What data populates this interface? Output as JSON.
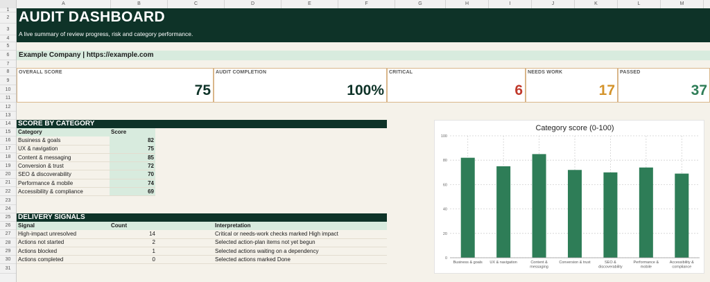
{
  "columns": [
    "A",
    "B",
    "C",
    "D",
    "E",
    "F",
    "G",
    "H",
    "I",
    "J",
    "K",
    "L",
    "M"
  ],
  "rows": [
    "1",
    "2",
    "3",
    "4",
    "5",
    "6",
    "7",
    "8",
    "9",
    "10",
    "11",
    "12",
    "13",
    "14",
    "15",
    "16",
    "17",
    "18",
    "19",
    "20",
    "21",
    "22",
    "23",
    "24",
    "25",
    "26",
    "27",
    "28",
    "29",
    "30",
    "31"
  ],
  "header": {
    "title": "AUDIT DASHBOARD",
    "subtitle": "A live summary of review progress, risk and category performance.",
    "company": "Example Company  |  https://example.com"
  },
  "cards": [
    {
      "label": "OVERALL SCORE",
      "value": "75",
      "color": "#0e3328"
    },
    {
      "label": "AUDIT COMPLETION",
      "value": "100%",
      "color": "#0e3328"
    },
    {
      "label": "CRITICAL",
      "value": "6",
      "color": "#c0392b"
    },
    {
      "label": "NEEDS WORK",
      "value": "17",
      "color": "#d4932a"
    },
    {
      "label": "PASSED",
      "value": "37",
      "color": "#2e7d57"
    }
  ],
  "score_section": {
    "title": "SCORE BY CATEGORY",
    "col_category": "Category",
    "col_score": "Score",
    "rows": [
      {
        "category": "Business & goals",
        "score": "82"
      },
      {
        "category": "UX & navigation",
        "score": "75"
      },
      {
        "category": "Content & messaging",
        "score": "85"
      },
      {
        "category": "Conversion & trust",
        "score": "72"
      },
      {
        "category": "SEO & discoverability",
        "score": "70"
      },
      {
        "category": "Performance & mobile",
        "score": "74"
      },
      {
        "category": "Accessibility & compliance",
        "score": "69"
      }
    ]
  },
  "delivery_section": {
    "title": "DELIVERY SIGNALS",
    "col_signal": "Signal",
    "col_count": "Count",
    "col_interp": "Interpretation",
    "rows": [
      {
        "signal": "High-impact unresolved",
        "count": "14",
        "interp": "Critical or needs-work checks marked High impact"
      },
      {
        "signal": "Actions not started",
        "count": "2",
        "interp": "Selected action-plan items not yet begun"
      },
      {
        "signal": "Actions blocked",
        "count": "1",
        "interp": "Selected actions waiting on a dependency"
      },
      {
        "signal": "Actions completed",
        "count": "0",
        "interp": "Selected actions marked Done"
      }
    ]
  },
  "chart_data": {
    "type": "bar",
    "title": "Category score (0-100)",
    "categories": [
      "Business & goals",
      "UX & navigation",
      "Content & messaging",
      "Conversion & trust",
      "SEO & discoverability",
      "Performance & mobile",
      "Accessibility & compliance"
    ],
    "category_lines": [
      [
        "Business & goals"
      ],
      [
        "UX & navigation"
      ],
      [
        "Content &",
        "messaging"
      ],
      [
        "Conversion & trust"
      ],
      [
        "SEO &",
        "discoverability"
      ],
      [
        "Performance &",
        "mobile"
      ],
      [
        "Accessibility &",
        "compliance"
      ]
    ],
    "values": [
      82,
      75,
      85,
      72,
      70,
      74,
      69
    ],
    "ylim": [
      0,
      100
    ],
    "yticks": [
      0,
      20,
      40,
      60,
      80,
      100
    ],
    "xlabel": "",
    "ylabel": "",
    "grid": true,
    "bar_color": "#2e7d57"
  }
}
